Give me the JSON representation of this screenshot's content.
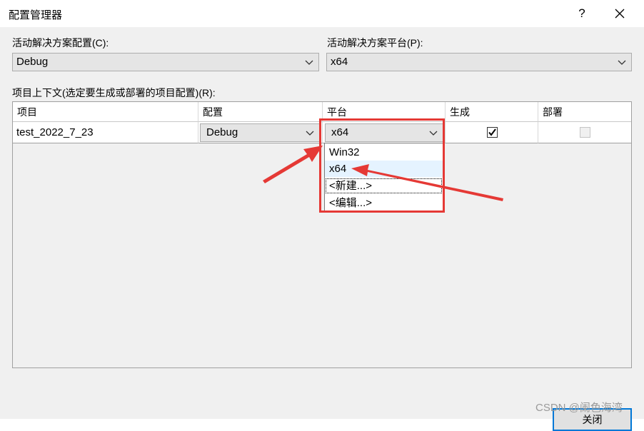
{
  "window": {
    "title": "配置管理器",
    "help_label": "?"
  },
  "active_config": {
    "label": "活动解决方案配置(C):",
    "value": "Debug"
  },
  "active_platform": {
    "label": "活动解决方案平台(P):",
    "value": "x64"
  },
  "context_label": "项目上下文(选定要生成或部署的项目配置)(R):",
  "grid": {
    "columns": [
      "项目",
      "配置",
      "平台",
      "生成",
      "部署"
    ],
    "rows": [
      {
        "project": "test_2022_7_23",
        "configuration": "Debug",
        "platform": "x64",
        "build": true,
        "deploy": false
      }
    ]
  },
  "platform_dropdown": {
    "options": [
      "Win32",
      "x64",
      "<新建...>",
      "<编辑...>"
    ],
    "hovered": "x64",
    "focused": "<新建...>"
  },
  "buttons": {
    "close": "关闭"
  },
  "watermark": "CSDN @阑色海湾",
  "colors": {
    "annotation_red": "#e53935",
    "focus_blue": "#0078d7"
  }
}
